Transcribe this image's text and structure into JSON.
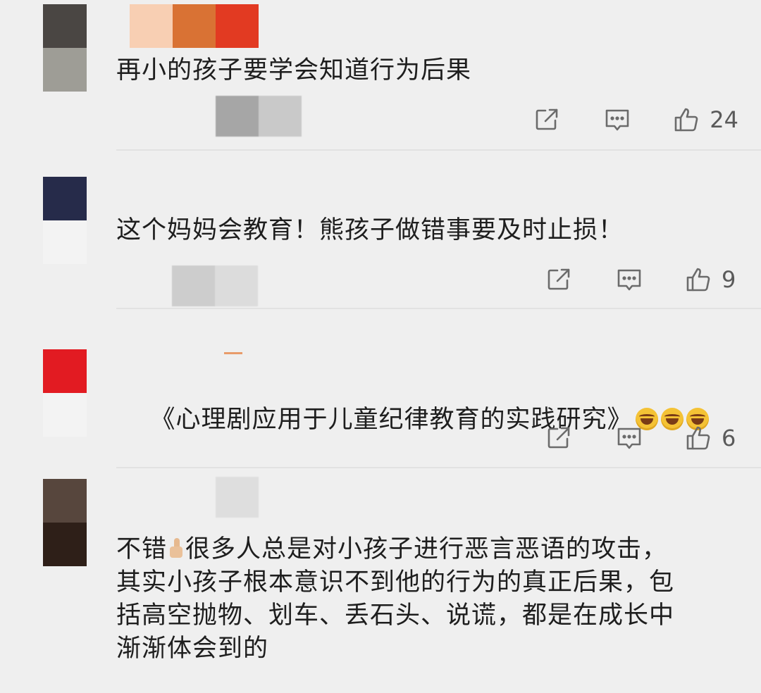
{
  "colors": {
    "background": "#efefef",
    "text": "#1e1e1e",
    "icon": "#6b6b6b",
    "divider": "#e2e2e2"
  },
  "comments": [
    {
      "avatar_colors": [
        "#4a4643",
        "#9e9d96"
      ],
      "name_blur_colors": [
        "#a6a6a6",
        "#c9c9c9"
      ],
      "text": "再小的孩子要学会知道行为后果",
      "likes": "24"
    },
    {
      "avatar_colors": [
        "#262b4a",
        "#f3f3f3"
      ],
      "name_blur_colors": [
        "#cdcdcd",
        "#dcdcdc"
      ],
      "text": "这个妈妈会教育！熊孩子做错事要及时止损！",
      "likes": "9"
    },
    {
      "avatar_colors": [
        "#e21b22",
        "#f3f3f3"
      ],
      "name_blur_colors": [
        "#f0f0f0",
        "#f0f0f0"
      ],
      "text": "《心理剧应用于儿童纪律教育的实践研究》",
      "likes": "6"
    },
    {
      "avatar_colors": [
        "#57463d",
        "#2e1f18"
      ],
      "name_blur_colors": [
        "#efefef",
        "#dedede"
      ],
      "text_before": "不错",
      "text_after": "很多人总是对小孩子进行恶言恶语的攻击，\n其实小孩子根本意识不到他的行为的真正后果，包\n括高空抛物、划车、丢石头、说谎，都是在成长中\n渐渐体会到的",
      "likes": ""
    }
  ],
  "top_strip_colors": [
    "#f8cfb3",
    "#d97234",
    "#e23a22"
  ],
  "icons": {
    "share": "share-icon",
    "reply": "comment-icon",
    "like": "thumbs-up-icon",
    "laugh": "laughing-emoji-icon",
    "thumb": "thumbs-up-emoji-icon"
  }
}
